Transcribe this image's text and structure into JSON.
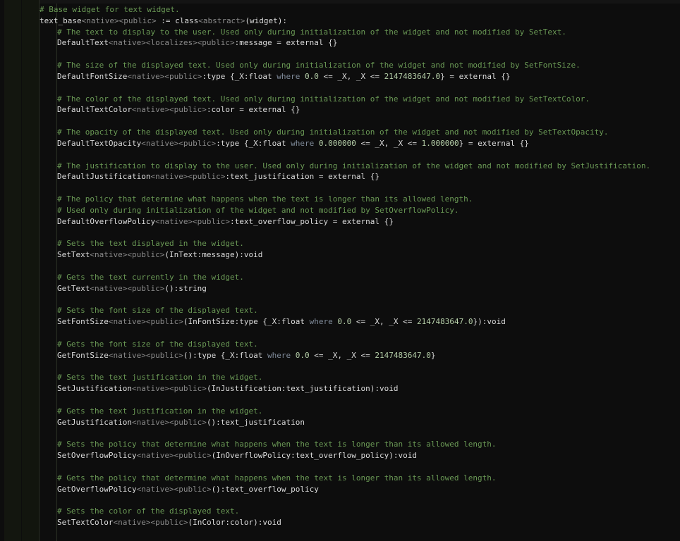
{
  "lines": [
    {
      "indent": 0,
      "tokens": [
        {
          "t": "# Base widget for text widget.",
          "c": "comment"
        }
      ]
    },
    {
      "indent": 0,
      "tokens": [
        {
          "t": "text_base",
          "c": "ident"
        },
        {
          "t": "<native><public>",
          "c": "spec"
        },
        {
          "t": " := ",
          "c": "punct"
        },
        {
          "t": "class",
          "c": "ident"
        },
        {
          "t": "<abstract>",
          "c": "spec"
        },
        {
          "t": "(widget):",
          "c": "ident"
        }
      ]
    },
    {
      "indent": 1,
      "tokens": [
        {
          "t": "# The text to display to the user. Used only during initialization of the widget and not modified by SetText.",
          "c": "comment"
        }
      ]
    },
    {
      "indent": 1,
      "tokens": [
        {
          "t": "DefaultText",
          "c": "ident"
        },
        {
          "t": "<native><localizes><public>",
          "c": "spec"
        },
        {
          "t": ":message = external {}",
          "c": "ident"
        }
      ]
    },
    {
      "indent": 1,
      "tokens": []
    },
    {
      "indent": 1,
      "tokens": [
        {
          "t": "# The size of the displayed text. Used only during initialization of the widget and not modified by SetFontSize.",
          "c": "comment"
        }
      ]
    },
    {
      "indent": 1,
      "tokens": [
        {
          "t": "DefaultFontSize",
          "c": "ident"
        },
        {
          "t": "<native><public>",
          "c": "spec"
        },
        {
          "t": ":type {_X:float ",
          "c": "ident"
        },
        {
          "t": "where",
          "c": "kw"
        },
        {
          "t": " 0.0 ",
          "c": "num"
        },
        {
          "t": "<= _X, _X <= ",
          "c": "ident"
        },
        {
          "t": "2147483647.0",
          "c": "num"
        },
        {
          "t": "} = external {}",
          "c": "ident"
        }
      ]
    },
    {
      "indent": 1,
      "tokens": []
    },
    {
      "indent": 1,
      "tokens": [
        {
          "t": "# The color of the displayed text. Used only during initialization of the widget and not modified by SetTextColor.",
          "c": "comment"
        }
      ]
    },
    {
      "indent": 1,
      "tokens": [
        {
          "t": "DefaultTextColor",
          "c": "ident"
        },
        {
          "t": "<native><public>",
          "c": "spec"
        },
        {
          "t": ":color = external {}",
          "c": "ident"
        }
      ]
    },
    {
      "indent": 1,
      "tokens": []
    },
    {
      "indent": 1,
      "tokens": [
        {
          "t": "# The opacity of the displayed text. Used only during initialization of the widget and not modified by SetTextOpacity.",
          "c": "comment"
        }
      ]
    },
    {
      "indent": 1,
      "tokens": [
        {
          "t": "DefaultTextOpacity",
          "c": "ident"
        },
        {
          "t": "<native><public>",
          "c": "spec"
        },
        {
          "t": ":type {_X:float ",
          "c": "ident"
        },
        {
          "t": "where",
          "c": "kw"
        },
        {
          "t": " 0.000000 ",
          "c": "num"
        },
        {
          "t": "<= _X, _X <= ",
          "c": "ident"
        },
        {
          "t": "1.000000",
          "c": "num"
        },
        {
          "t": "} = external {}",
          "c": "ident"
        }
      ]
    },
    {
      "indent": 1,
      "tokens": []
    },
    {
      "indent": 1,
      "tokens": [
        {
          "t": "# The justification to display to the user. Used only during initialization of the widget and not modified by SetJustification.",
          "c": "comment"
        }
      ]
    },
    {
      "indent": 1,
      "tokens": [
        {
          "t": "DefaultJustification",
          "c": "ident"
        },
        {
          "t": "<native><public>",
          "c": "spec"
        },
        {
          "t": ":text_justification = external {}",
          "c": "ident"
        }
      ]
    },
    {
      "indent": 1,
      "tokens": []
    },
    {
      "indent": 1,
      "tokens": [
        {
          "t": "# The policy that determine what happens when the text is longer than its allowed length.",
          "c": "comment"
        }
      ]
    },
    {
      "indent": 1,
      "tokens": [
        {
          "t": "# Used only during initialization of the widget and not modified by SetOverflowPolicy.",
          "c": "comment"
        }
      ]
    },
    {
      "indent": 1,
      "tokens": [
        {
          "t": "DefaultOverflowPolicy",
          "c": "ident"
        },
        {
          "t": "<native><public>",
          "c": "spec"
        },
        {
          "t": ":text_overflow_policy = external {}",
          "c": "ident"
        }
      ]
    },
    {
      "indent": 1,
      "tokens": []
    },
    {
      "indent": 1,
      "tokens": [
        {
          "t": "# Sets the text displayed in the widget.",
          "c": "comment"
        }
      ]
    },
    {
      "indent": 1,
      "tokens": [
        {
          "t": "SetText",
          "c": "ident"
        },
        {
          "t": "<native><public>",
          "c": "spec"
        },
        {
          "t": "(InText:message):void",
          "c": "ident"
        }
      ]
    },
    {
      "indent": 1,
      "tokens": []
    },
    {
      "indent": 1,
      "tokens": [
        {
          "t": "# Gets the text currently in the widget.",
          "c": "comment"
        }
      ]
    },
    {
      "indent": 1,
      "tokens": [
        {
          "t": "GetText",
          "c": "ident"
        },
        {
          "t": "<native><public>",
          "c": "spec"
        },
        {
          "t": "():string",
          "c": "ident"
        }
      ]
    },
    {
      "indent": 1,
      "tokens": []
    },
    {
      "indent": 1,
      "tokens": [
        {
          "t": "# Sets the font size of the displayed text.",
          "c": "comment"
        }
      ]
    },
    {
      "indent": 1,
      "tokens": [
        {
          "t": "SetFontSize",
          "c": "ident"
        },
        {
          "t": "<native><public>",
          "c": "spec"
        },
        {
          "t": "(InFontSize:type {_X:float ",
          "c": "ident"
        },
        {
          "t": "where",
          "c": "kw"
        },
        {
          "t": " 0.0 ",
          "c": "num"
        },
        {
          "t": "<= _X, _X <= ",
          "c": "ident"
        },
        {
          "t": "2147483647.0",
          "c": "num"
        },
        {
          "t": "}):void",
          "c": "ident"
        }
      ]
    },
    {
      "indent": 1,
      "tokens": []
    },
    {
      "indent": 1,
      "tokens": [
        {
          "t": "# Gets the font size of the displayed text.",
          "c": "comment"
        }
      ]
    },
    {
      "indent": 1,
      "tokens": [
        {
          "t": "GetFontSize",
          "c": "ident"
        },
        {
          "t": "<native><public>",
          "c": "spec"
        },
        {
          "t": "():type {_X:float ",
          "c": "ident"
        },
        {
          "t": "where",
          "c": "kw"
        },
        {
          "t": " 0.0 ",
          "c": "num"
        },
        {
          "t": "<= _X, _X <= ",
          "c": "ident"
        },
        {
          "t": "2147483647.0",
          "c": "num"
        },
        {
          "t": "}",
          "c": "ident"
        }
      ]
    },
    {
      "indent": 1,
      "tokens": []
    },
    {
      "indent": 1,
      "tokens": [
        {
          "t": "# Sets the text justification in the widget.",
          "c": "comment"
        }
      ]
    },
    {
      "indent": 1,
      "tokens": [
        {
          "t": "SetJustification",
          "c": "ident"
        },
        {
          "t": "<native><public>",
          "c": "spec"
        },
        {
          "t": "(InJustification:text_justification):void",
          "c": "ident"
        }
      ]
    },
    {
      "indent": 1,
      "tokens": []
    },
    {
      "indent": 1,
      "tokens": [
        {
          "t": "# Gets the text justification in the widget.",
          "c": "comment"
        }
      ]
    },
    {
      "indent": 1,
      "tokens": [
        {
          "t": "GetJustification",
          "c": "ident"
        },
        {
          "t": "<native><public>",
          "c": "spec"
        },
        {
          "t": "():text_justification",
          "c": "ident"
        }
      ]
    },
    {
      "indent": 1,
      "tokens": []
    },
    {
      "indent": 1,
      "tokens": [
        {
          "t": "# Sets the policy that determine what happens when the text is longer than its allowed length.",
          "c": "comment"
        }
      ]
    },
    {
      "indent": 1,
      "tokens": [
        {
          "t": "SetOverflowPolicy",
          "c": "ident"
        },
        {
          "t": "<native><public>",
          "c": "spec"
        },
        {
          "t": "(InOverflowPolicy:text_overflow_policy):void",
          "c": "ident"
        }
      ]
    },
    {
      "indent": 1,
      "tokens": []
    },
    {
      "indent": 1,
      "tokens": [
        {
          "t": "# Gets the policy that determine what happens when the text is longer than its allowed length.",
          "c": "comment"
        }
      ]
    },
    {
      "indent": 1,
      "tokens": [
        {
          "t": "GetOverflowPolicy",
          "c": "ident"
        },
        {
          "t": "<native><public>",
          "c": "spec"
        },
        {
          "t": "():text_overflow_policy",
          "c": "ident"
        }
      ]
    },
    {
      "indent": 1,
      "tokens": []
    },
    {
      "indent": 1,
      "tokens": [
        {
          "t": "# Sets the color of the displayed text.",
          "c": "comment"
        }
      ]
    },
    {
      "indent": 1,
      "tokens": [
        {
          "t": "SetTextColor",
          "c": "ident"
        },
        {
          "t": "<native><public>",
          "c": "spec"
        },
        {
          "t": "(InColor:color):void",
          "c": "ident"
        }
      ]
    },
    {
      "indent": 1,
      "tokens": []
    }
  ],
  "colors": {
    "background": "#0d0d0d",
    "comment": "#6a9955",
    "identifier": "#dcdcdc",
    "specifier": "#8a8a8a",
    "keyword": "#7f8a99",
    "number": "#b5cea8"
  }
}
